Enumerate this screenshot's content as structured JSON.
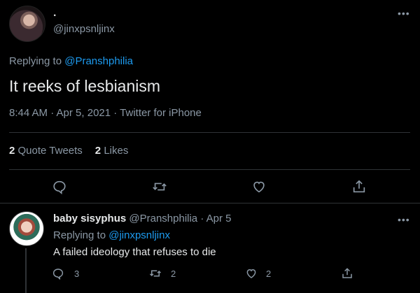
{
  "tweet": {
    "display_name": ".",
    "handle": "@jinxpsnljinx",
    "replying_prefix": "Replying to",
    "replying_to": "@Pranshphilia",
    "text": "It reeks of lesbianism",
    "meta": "8:44 AM · Apr 5, 2021 · Twitter for iPhone",
    "quote_tweets_count": "2",
    "quote_tweets_label": "Quote Tweets",
    "likes_count": "2",
    "likes_label": "Likes"
  },
  "reply": {
    "display_name": "baby sisyphus",
    "handle_date": "@Pranshphilia · Apr 5",
    "replying_prefix": "Replying to",
    "replying_to": "@jinxpsnljinx",
    "text": "A failed ideology that refuses to die",
    "reply_count": "3",
    "retweet_count": "2",
    "like_count": "2"
  },
  "icons": {
    "more": "more-icon",
    "reply": "reply-icon",
    "retweet": "retweet-icon",
    "like": "heart-icon",
    "share": "share-icon"
  },
  "colors": {
    "background": "#000000",
    "accent": "#1d9bf0",
    "secondary_text": "#8b98a5"
  }
}
